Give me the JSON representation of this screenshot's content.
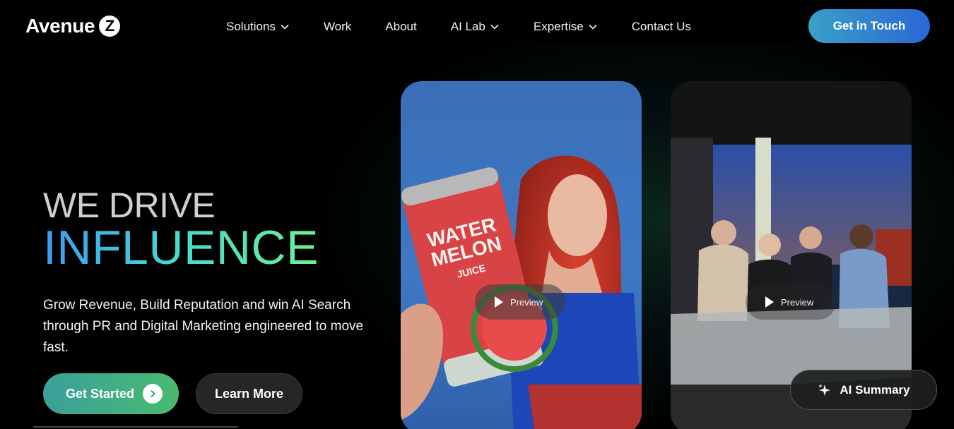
{
  "header": {
    "logo_text": "Avenue",
    "logo_badge": "Z",
    "nav": [
      {
        "label": "Solutions",
        "has_dropdown": true
      },
      {
        "label": "Work",
        "has_dropdown": false
      },
      {
        "label": "About",
        "has_dropdown": false
      },
      {
        "label": "AI Lab",
        "has_dropdown": true
      },
      {
        "label": "Expertise",
        "has_dropdown": true
      },
      {
        "label": "Contact Us",
        "has_dropdown": false
      }
    ],
    "cta_label": "Get in Touch"
  },
  "hero": {
    "line1": "WE DRIVE",
    "line2": "INFLUENCE",
    "subtitle": "Grow Revenue, Build Reputation and win AI Search through PR and Digital Marketing engineered to move fast.",
    "primary_button": "Get Started",
    "secondary_button": "Learn More"
  },
  "cards": [
    {
      "preview_label": "Preview",
      "can_text_top": "WATER",
      "can_text_mid": "MELON",
      "can_text_bottom": "JUICE"
    },
    {
      "preview_label": "Preview"
    }
  ],
  "ai_summary_label": "AI Summary",
  "colors": {
    "accent_blue": "#2a66d6",
    "accent_green": "#4aba6e",
    "gradient_start": "#3d9cf2",
    "gradient_end": "#6fef93"
  }
}
